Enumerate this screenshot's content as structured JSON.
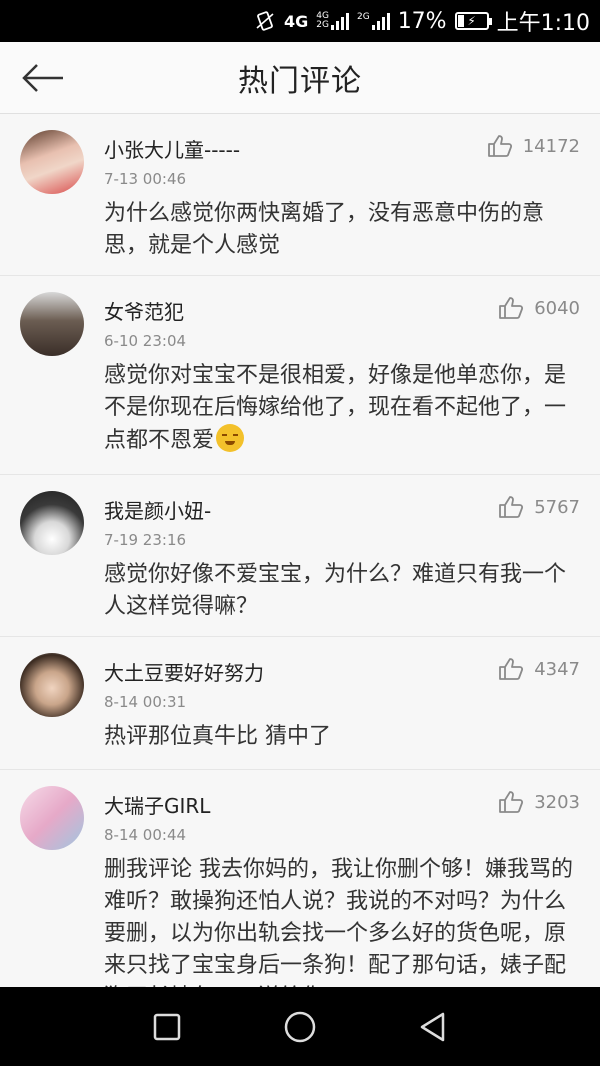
{
  "status_bar": {
    "network_1": "4G",
    "network_2": "4G",
    "network_3": "2G",
    "network_4": "2G",
    "battery": "17%",
    "time": "上午1:10"
  },
  "header": {
    "title": "热门评论"
  },
  "comments": [
    {
      "username": "小张大儿童-----",
      "date": "7-13 00:46",
      "likes": "14172",
      "content": "为什么感觉你两快离婚了，没有恶意中伤的意思，就是个人感觉",
      "avatar_color": "#d94b4b"
    },
    {
      "username": "女爷范犯",
      "date": "6-10 23:04",
      "likes": "6040",
      "content": "感觉你对宝宝不是很相爱，好像是他单恋你，是不是你现在后悔嫁给他了，现在看不起他了，一点都不恩爱",
      "avatar_color": "#6b5d52"
    },
    {
      "username": "我是颜小妞-",
      "date": "7-19 23:16",
      "likes": "5767",
      "content": "感觉你好像不爱宝宝，为什么？难道只有我一个人这样觉得嘛？",
      "avatar_color": "#3a3a3a"
    },
    {
      "username": "大土豆要好好努力",
      "date": "8-14 00:31",
      "likes": "4347",
      "content": "热评那位真牛比 猜中了",
      "avatar_color": "#c9a58a"
    },
    {
      "username": "大瑞子GIRL",
      "date": "8-14 00:44",
      "likes": "3203",
      "content": "删我评论 我去你妈的，我让你删个够！嫌我骂的难听？敢操狗还怕人说？我说的不对吗？为什么要删，以为你出轨会找一个多么好的货色呢，原来只找了宝宝身后一条狗！配了那句话，婊子配狗天长地久！！送给你",
      "avatar_color": "#e6a9c8"
    }
  ],
  "nav_bar": {
    "recent_icon": "square-icon",
    "home_icon": "circle-icon",
    "back_icon": "triangle-icon"
  }
}
